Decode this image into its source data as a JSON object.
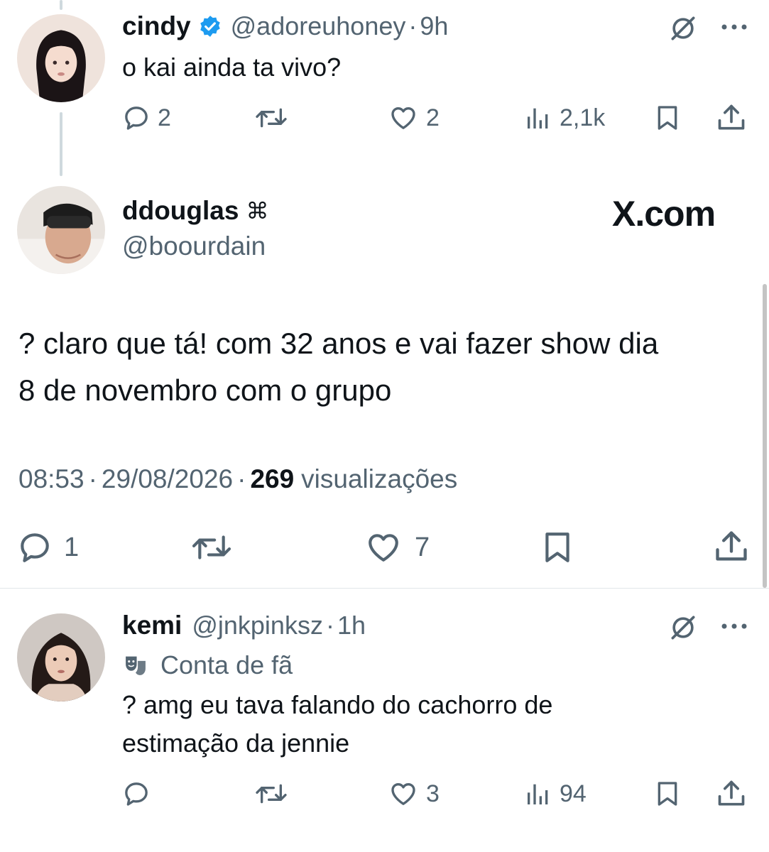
{
  "top_reply": {
    "name": "cindy",
    "handle": "@adoreuhoney",
    "separator": "·",
    "time": "9h",
    "text": "o kai ainda ta vivo?",
    "replies": "2",
    "likes": "2",
    "views": "2,1k"
  },
  "main_tweet": {
    "name": "ddouglas",
    "name_symbol": "⌘",
    "handle": "@boourdain",
    "brand": "X.com",
    "text_line1": "? claro que tá! com 32 anos e vai fazer show dia",
    "text_line2": "8 de novembro com o grupo",
    "time": "08:53",
    "separator": "·",
    "date": "29/08/2026",
    "views_count": "269",
    "views_label": "visualizações",
    "replies": "1",
    "likes": "7"
  },
  "bottom_reply": {
    "name": "kemi",
    "handle": "@jnkpinksz",
    "separator": "·",
    "time": "1h",
    "label": "Conta de fã",
    "text_line1": "? amg eu tava falando do cachorro de",
    "text_line2": "estimação da jennie",
    "likes": "3",
    "views": "94"
  },
  "icons": {
    "verified": "verified-badge-icon",
    "grok": "grok-icon",
    "more": "more-icon",
    "reply": "reply-icon",
    "retweet": "retweet-icon",
    "like": "like-icon",
    "views": "views-icon",
    "bookmark": "bookmark-icon",
    "share": "share-icon",
    "fan": "theater-masks-icon"
  },
  "colors": {
    "verified": "#1d9bf0",
    "text": "#0f1419",
    "muted": "#536471"
  }
}
